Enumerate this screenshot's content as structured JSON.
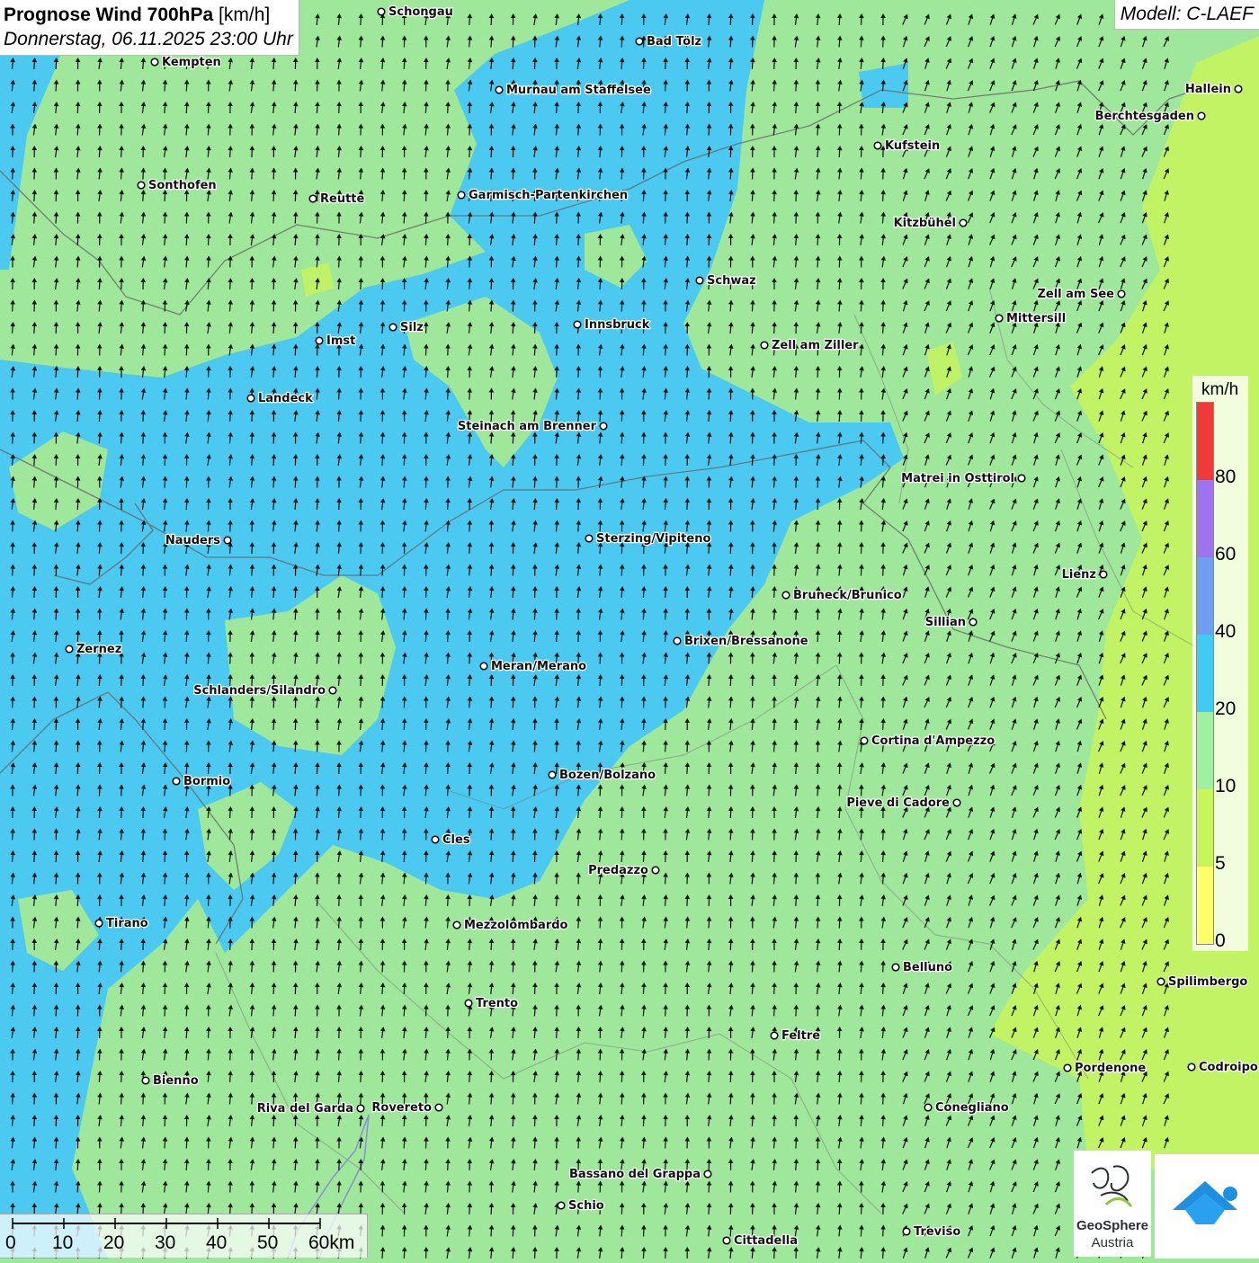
{
  "header": {
    "title_bold": "Prognose Wind 700hPa",
    "title_unit": "[km/h]",
    "datetime": "Donnerstag, 06.11.2025 23:00 Uhr",
    "model": "Modell: C-LAEF"
  },
  "legend": {
    "unit": "km/h",
    "classes": [
      {
        "from": 0,
        "to": 5,
        "color": "#ffff6b"
      },
      {
        "from": 5,
        "to": 10,
        "color": "#c7f55a"
      },
      {
        "from": 10,
        "to": 20,
        "color": "#9ff0a0"
      },
      {
        "from": 20,
        "to": 40,
        "color": "#42cbf2"
      },
      {
        "from": 40,
        "to": 60,
        "color": "#6e9df2"
      },
      {
        "from": 60,
        "to": 80,
        "color": "#9d74ee"
      },
      {
        "from": 80,
        "to": 100,
        "color": "#f03a3a"
      }
    ],
    "tick_labels": [
      "0",
      "5",
      "10",
      "20",
      "40",
      "60",
      "80"
    ]
  },
  "scalebar": {
    "labels": [
      "0",
      "10",
      "20",
      "30",
      "40",
      "50",
      "60km"
    ]
  },
  "logos": {
    "left_line1": "GeoSphere",
    "left_line2": "Austria"
  },
  "map": {
    "colors": {
      "calm": "#c7f55a",
      "light": "#9fe79a",
      "moderate": "#4bc9f0",
      "arrow": "#111111",
      "border": "#666666"
    },
    "cities": [
      {
        "name": "Schongau"
      },
      {
        "name": "Bad Tölz"
      },
      {
        "name": "Kempten"
      },
      {
        "name": "Murnau am Staffelsee"
      },
      {
        "name": "Hallein"
      },
      {
        "name": "Berchtesgaden"
      },
      {
        "name": "Kufstein"
      },
      {
        "name": "Sonthofen"
      },
      {
        "name": "Reutte"
      },
      {
        "name": "Garmisch-Partenkirchen"
      },
      {
        "name": "Kitzbühel"
      },
      {
        "name": "Schwaz"
      },
      {
        "name": "Zell am See"
      },
      {
        "name": "Mittersill"
      },
      {
        "name": "Silz"
      },
      {
        "name": "Innsbruck"
      },
      {
        "name": "Imst"
      },
      {
        "name": "Zell am Ziller"
      },
      {
        "name": "Landeck"
      },
      {
        "name": "Steinach am Brenner"
      },
      {
        "name": "Matrei in Osttirol"
      },
      {
        "name": "Nauders"
      },
      {
        "name": "Sterzing/Vipiteno"
      },
      {
        "name": "Lienz"
      },
      {
        "name": "Bruneck/Brunico"
      },
      {
        "name": "Sillian"
      },
      {
        "name": "Brixen/Bressanone"
      },
      {
        "name": "Zernez"
      },
      {
        "name": "Meran/Merano"
      },
      {
        "name": "Schlanders/Silandro"
      },
      {
        "name": "Cortina d'Ampezzo"
      },
      {
        "name": "Bozen/Bolzano"
      },
      {
        "name": "Bormio"
      },
      {
        "name": "Pieve di Cadore"
      },
      {
        "name": "Cles"
      },
      {
        "name": "Predazzo"
      },
      {
        "name": "Tirano"
      },
      {
        "name": "Mezzolombardo"
      },
      {
        "name": "Belluno"
      },
      {
        "name": "Spilimbergo"
      },
      {
        "name": "Trento"
      },
      {
        "name": "Feltre"
      },
      {
        "name": "Bienno"
      },
      {
        "name": "Pordenone"
      },
      {
        "name": "Codroipo"
      },
      {
        "name": "Riva del Garda"
      },
      {
        "name": "Rovereto"
      },
      {
        "name": "Conegliano"
      },
      {
        "name": "Bassano del Grappa"
      },
      {
        "name": "Schio"
      },
      {
        "name": "Treviso"
      },
      {
        "name": "Cittadella"
      }
    ]
  }
}
